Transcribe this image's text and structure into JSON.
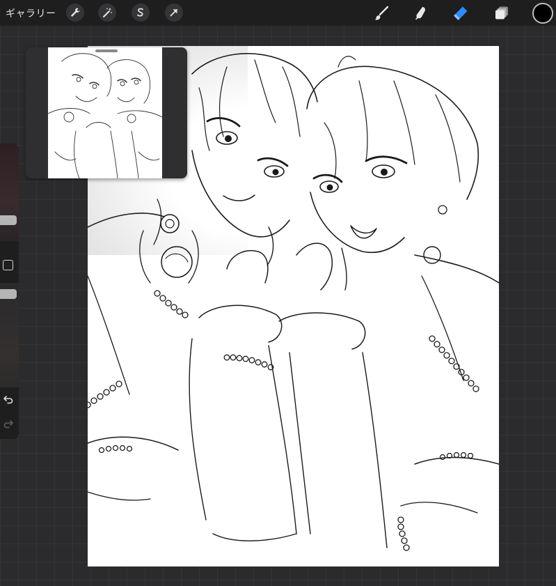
{
  "toolbar": {
    "gallery_label": "ギャラリー",
    "left_tools": [
      "wrench-icon",
      "magic-wand-icon",
      "selection-icon",
      "transform-arrow-icon"
    ],
    "right_tools": [
      "brush-icon",
      "smudge-icon",
      "eraser-icon",
      "layers-icon"
    ],
    "active_tool": "eraser-icon",
    "active_color": "#000000",
    "accent_color": "#2f8bff"
  },
  "sidebar": {
    "brush_size_level": 0.78,
    "opacity_level": 1.0,
    "icons": [
      "modify-square-icon",
      "undo-icon",
      "redo-icon"
    ]
  },
  "reference_window": {
    "visible": true
  },
  "canvas": {
    "background": "#ffffff",
    "content": "line-art-sketch"
  }
}
